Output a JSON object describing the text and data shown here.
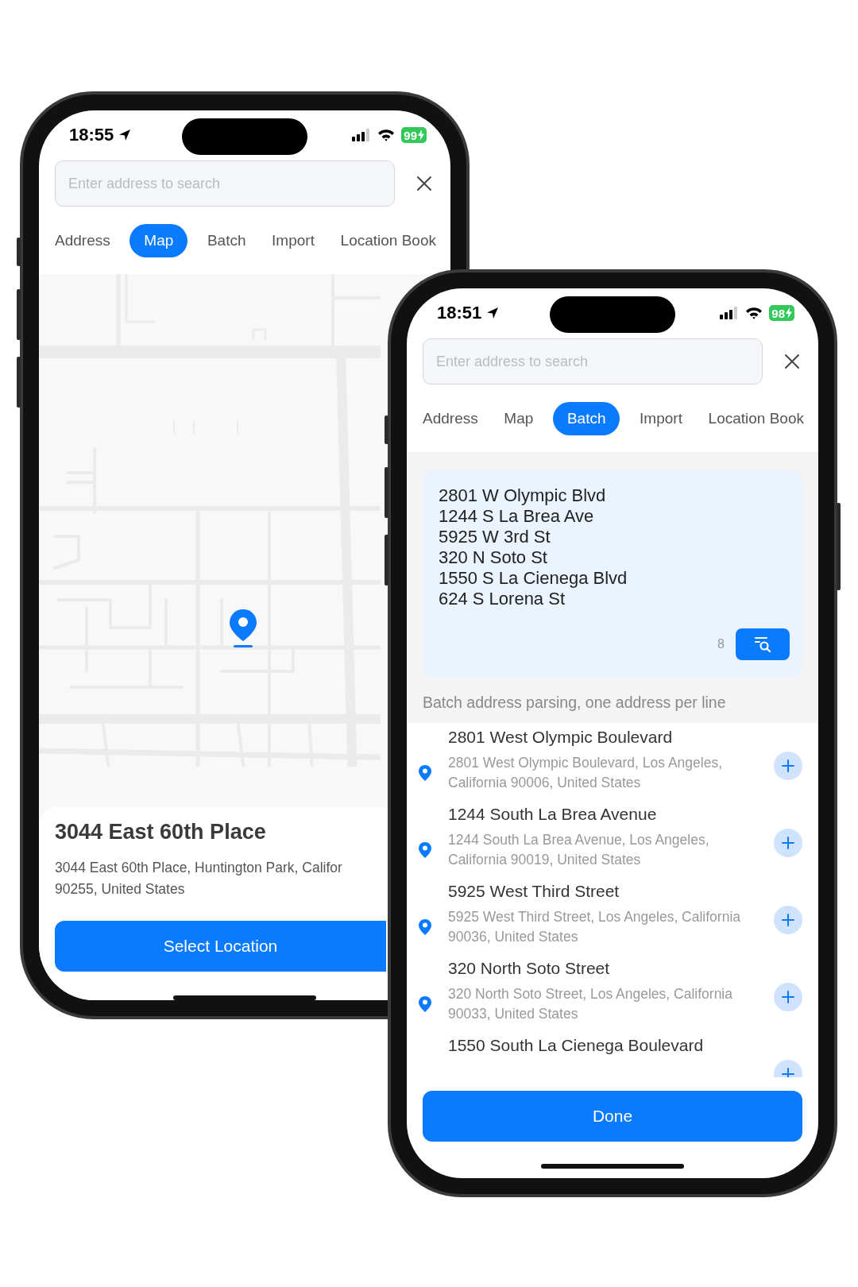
{
  "phones": [
    {
      "kind": "map",
      "status_bar": {
        "time": "18:55",
        "battery": "99"
      },
      "search": {
        "placeholder": "Enter address to search"
      },
      "tabs": [
        {
          "label": "Address",
          "selected": false
        },
        {
          "label": "Map",
          "selected": true
        },
        {
          "label": "Batch",
          "selected": false
        },
        {
          "label": "Import",
          "selected": false
        },
        {
          "label": "Location Book",
          "selected": false
        }
      ],
      "place": {
        "title": "3044 East 60th Place",
        "address_lines": [
          "3044 East 60th Place, Huntington Park, Califor",
          "90255, United States"
        ]
      },
      "action": "Select Location"
    },
    {
      "kind": "batch",
      "status_bar": {
        "time": "18:51",
        "battery": "98"
      },
      "search": {
        "placeholder": "Enter address to search"
      },
      "tabs": [
        {
          "label": "Address",
          "selected": false
        },
        {
          "label": "Map",
          "selected": false
        },
        {
          "label": "Batch",
          "selected": true
        },
        {
          "label": "Import",
          "selected": false
        },
        {
          "label": "Location Book",
          "selected": false
        }
      ],
      "batch_input": {
        "lines": [
          "2801 W Olympic Blvd",
          "1244 S La Brea Ave",
          "5925 W 3rd St",
          "320 N Soto St",
          "1550 S La Cienega Blvd",
          "624 S Lorena St"
        ],
        "count": "8"
      },
      "hint": "Batch address parsing, one address per line",
      "results": [
        {
          "title": "2801 West Olympic Boulevard",
          "subtitle": "2801 West Olympic Boulevard, Los Angeles, California 90006, United States"
        },
        {
          "title": "1244 South La Brea Avenue",
          "subtitle": "1244 South La Brea Avenue, Los Angeles, California 90019, United States"
        },
        {
          "title": "5925 West Third Street",
          "subtitle": "5925 West Third Street, Los Angeles, California 90036, United States"
        },
        {
          "title": "320 North Soto Street",
          "subtitle": "320 North Soto Street, Los Angeles, California 90033, United States"
        },
        {
          "title": "1550 South La Cienega Boulevard"
        }
      ],
      "action": "Done"
    }
  ]
}
